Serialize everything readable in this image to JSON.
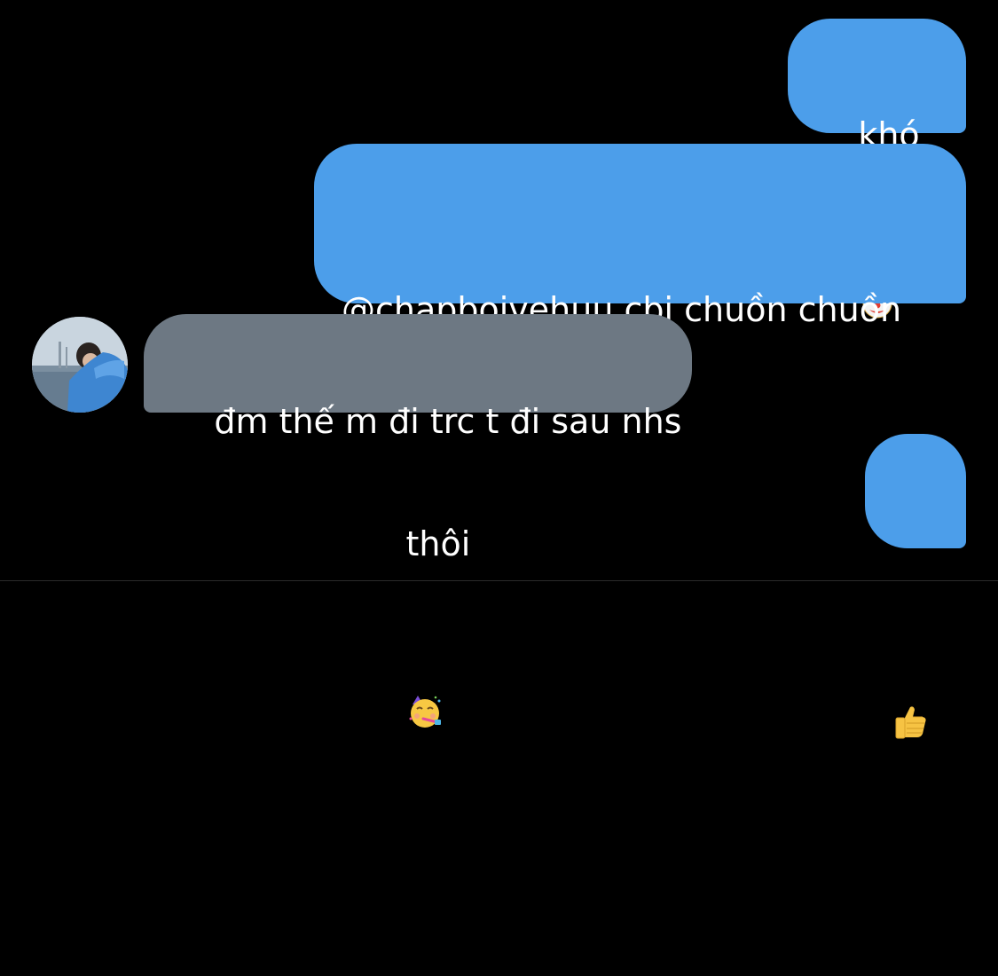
{
  "conversation": {
    "messages": [
      {
        "direction": "outgoing",
        "text": "khó",
        "emoji": "clown-face"
      },
      {
        "direction": "outgoing",
        "line1": "@chapboivehuu cbi chuồn chuồn",
        "line2": "thôi",
        "emoji": "partying-face"
      },
      {
        "direction": "incoming",
        "text": "đm thế m đi trc t đi sau nhs",
        "avatar": "contact-avatar"
      },
      {
        "direction": "outgoing",
        "emoji": "thumbs-up"
      }
    ]
  },
  "colors": {
    "background": "#000000",
    "outgoing_bubble": "#4c9eea",
    "incoming_bubble": "#6d7883",
    "text": "#ffffff"
  }
}
